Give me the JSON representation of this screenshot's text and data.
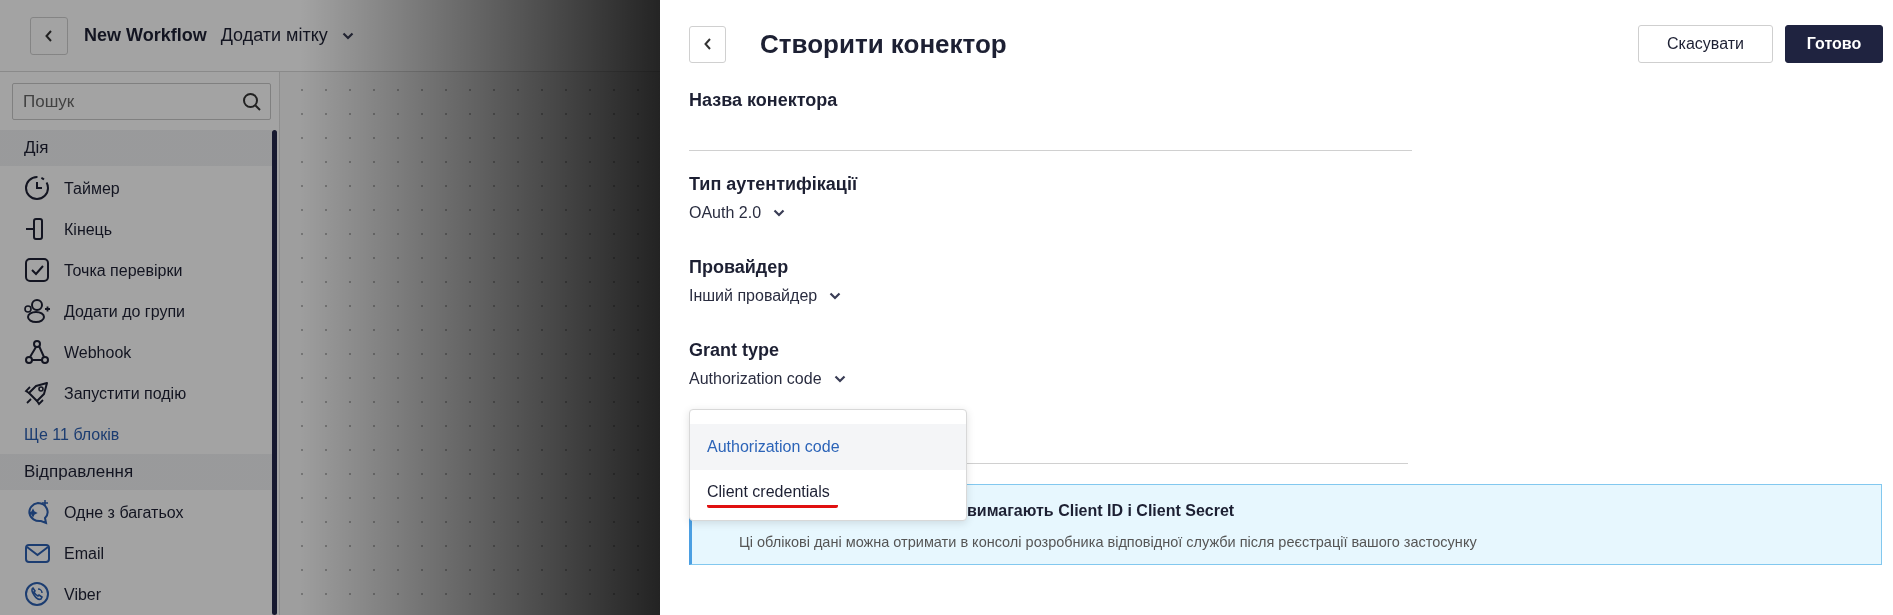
{
  "header": {
    "title": "New Workflow",
    "tag_dropdown": "Додати мітку"
  },
  "sidebar": {
    "search": {
      "placeholder": "Пошук"
    },
    "sections": [
      {
        "title": "Дія",
        "items": [
          {
            "label": "Таймер",
            "kind": "timer"
          },
          {
            "label": "Кінець",
            "kind": "end"
          },
          {
            "label": "Точка перевірки",
            "kind": "check"
          },
          {
            "label": "Додати до групи",
            "kind": "group"
          },
          {
            "label": "Webhook",
            "kind": "webhook"
          },
          {
            "label": "Запустити подію",
            "kind": "rocket"
          }
        ],
        "more": "Ще 11 блоків"
      },
      {
        "title": "Відправлення",
        "items": [
          {
            "label": "Одне з багатьох",
            "kind": "chat"
          },
          {
            "label": "Email",
            "kind": "email"
          },
          {
            "label": "Viber",
            "kind": "viber"
          }
        ]
      }
    ]
  },
  "panel": {
    "title": "Створити конектор",
    "buttons": [
      {
        "label": "Скасувати",
        "kind": "secondary"
      },
      {
        "label": "Готово",
        "kind": "primary"
      }
    ],
    "fields": [
      {
        "label": "Назва конектора",
        "kind": "input"
      },
      {
        "label": "Тип аутентифікації",
        "kind": "select",
        "value": "OAuth 2.0"
      },
      {
        "label": "Провайдер",
        "kind": "select",
        "value": "Інший провайдер"
      },
      {
        "label": "Grant type",
        "kind": "select",
        "value": "Authorization code",
        "expanded": true,
        "options": [
          {
            "label": "Authorization code",
            "selected": true,
            "underlined": false
          },
          {
            "label": "Client credentials",
            "selected": false,
            "underlined": true
          }
        ]
      }
    ],
    "info": {
      "title": "вимагають Client ID і Client Secret",
      "text": "Ці облікові дані можна отримати в консолі розробника відповідної служби після реєстрації вашого застосунку"
    }
  }
}
